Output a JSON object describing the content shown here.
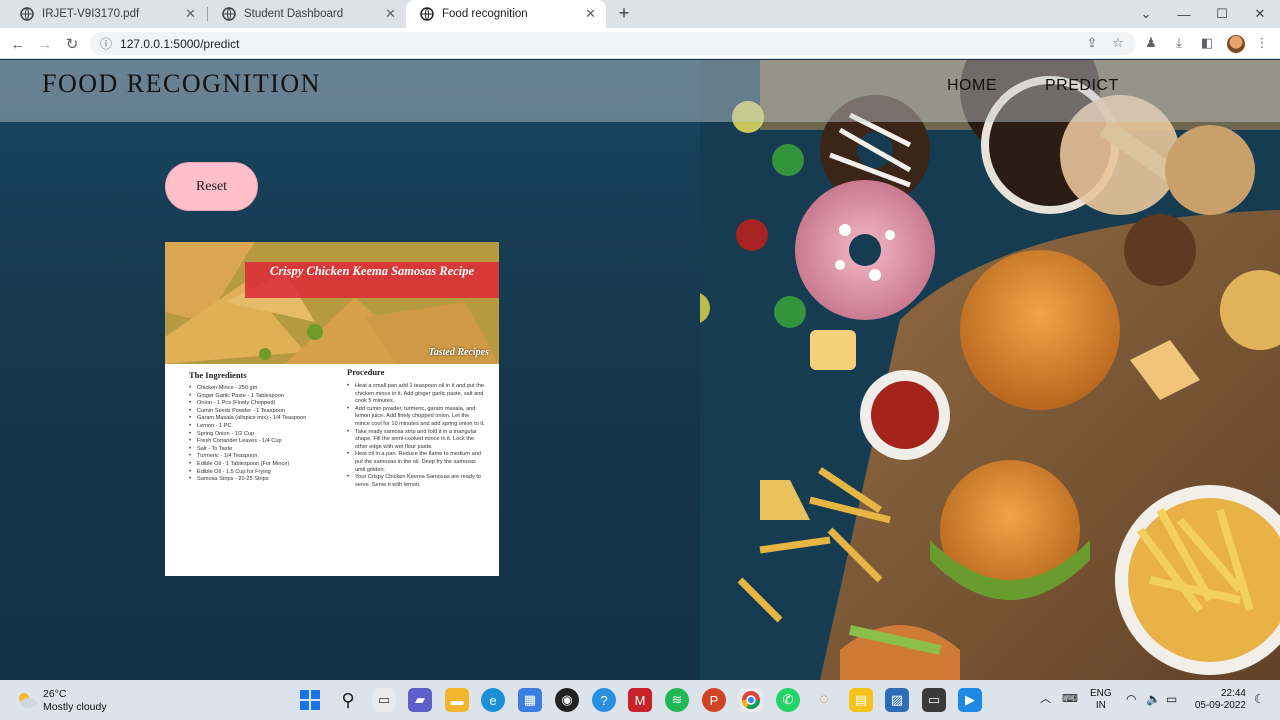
{
  "browser": {
    "tabs": [
      {
        "title": "IRJET-V9I3170.pdf",
        "active": false
      },
      {
        "title": "Student Dashboard",
        "active": false
      },
      {
        "title": "Food recognition",
        "active": true
      }
    ],
    "url": "127.0.0.1:5000/predict"
  },
  "site": {
    "brand": "FOOD RECOGNITION",
    "nav": {
      "home": "HOME",
      "predict": "PREDICT"
    },
    "reset_label": "Reset"
  },
  "recipe_image": {
    "title": "Crispy Chicken Keema Samosas Recipe",
    "stamp": "Tasted Recipes",
    "ingredients_heading": "The Ingredients",
    "ingredients": [
      "Chicken Mince - 250 gm",
      "Ginger Garlic Paste - 1 Tablespoon",
      "Onion - 1 Pcs (Finely Chopped)",
      "Cumin Seeds Powder - 1 Teaspoon",
      "Garam Masala (allspice mix) - 1/4 Teaspoon",
      "Lemon - 1 PC",
      "Spring Onion - 1/2 Cup",
      "Fresh Coriander Leaves - 1/4 Cup",
      "Salt - To Taste",
      "Turmeric - 1/4 Teaspoon",
      "Edible Oil - 1 Tablespoon (For Mince)",
      "Edible Oil - 1.5 Cup for Frying",
      "Samosa Strips - 20-25 Strips"
    ],
    "procedure_heading": "Procedure",
    "procedure": [
      "Heat a small pan add 1 teaspoon oil in it and put the chicken mince in it. Add ginger garlic paste, salt and cook 5 minutes.",
      "Add cumin powder, turmeric, garam masala, and lemon juice. Add finely chopped onion. Let the mince cool for 10 minutes and add spring onion to it.",
      "Take ready samosa strip and fold it in a triangular shape. Fill the semi-cooked mince in it. Lock the other edge with wet flour paste.",
      "Heat oil in a pan. Reduce the flame to medium and put the samosas in the oil. Deep fry the samosas until golden.",
      "Your Crispy Chicken Keema Samosas are ready to serve. Serve it with lemon."
    ]
  },
  "taskbar": {
    "weather_temp": "26°C",
    "weather_desc": "Mostly cloudy",
    "lang_line1": "ENG",
    "lang_line2": "IN",
    "time": "22:44",
    "date": "05-09-2022"
  },
  "colors": {
    "reset_button": "#ffc0cb",
    "page_background": "#16384a",
    "recipe_banner": "#dc2837"
  }
}
